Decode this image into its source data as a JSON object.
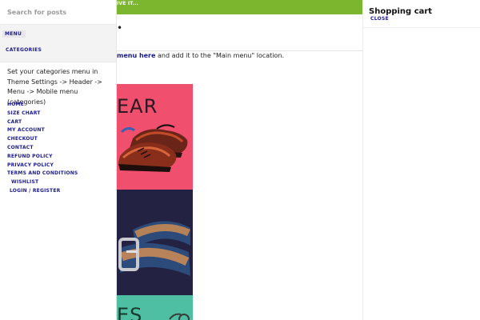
{
  "banner": {
    "text": "IVE IT..."
  },
  "main": {
    "bullet": "•",
    "instruction_link": "menu here",
    "instruction_rest": " and add it to the \"Main menu\" location."
  },
  "tiles": [
    {
      "word": "EAR"
    },
    {
      "word": ""
    },
    {
      "word": "ES"
    }
  ],
  "side_menu": {
    "search_placeholder": "Search for posts",
    "tab_menu": "MENU",
    "tab_categories": "CATEGORIES",
    "categories_note": "Set your categories menu in Theme Settings -> Header -> Menu -> Mobile menu (categories)",
    "items": [
      {
        "label": "HOME"
      },
      {
        "label": "SIZE CHART"
      },
      {
        "label": "CART"
      },
      {
        "label": "MY ACCOUNT"
      },
      {
        "label": "CHECKOUT"
      },
      {
        "label": "CONTACT"
      },
      {
        "label": "REFUND POLICY"
      },
      {
        "label": "PRIVACY POLICY"
      },
      {
        "label": "TERMS AND CONDITIONS"
      },
      {
        "label": "WISHLIST"
      },
      {
        "label": "LOGIN / REGISTER"
      }
    ]
  },
  "cart": {
    "title": "Shopping cart",
    "close_label": "CLOSE"
  },
  "colors": {
    "banner_green": "#7cb62f",
    "link_navy": "#1a1a8c",
    "tile_pink": "#f04f6e",
    "tile_navy": "#232243",
    "tile_teal": "#4ebfa2"
  },
  "icons": [
    "shoes-image",
    "belt-image",
    "watch-image"
  ]
}
